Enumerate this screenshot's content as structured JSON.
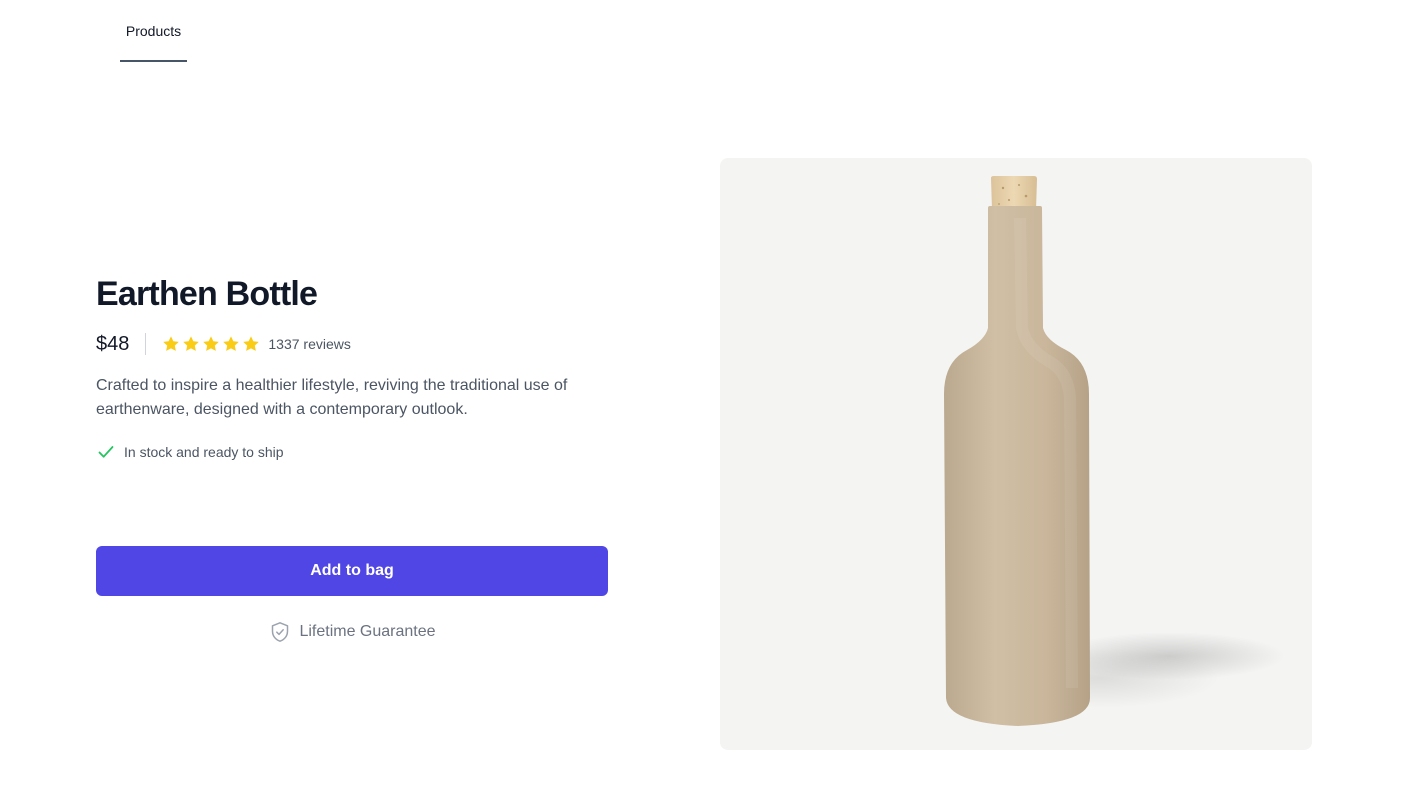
{
  "nav": {
    "tabs": [
      {
        "label": "Products",
        "active": true
      }
    ]
  },
  "product": {
    "name": "Earthen Bottle",
    "price": "$48",
    "rating": 5,
    "rating_max": 5,
    "reviews": "1337 reviews",
    "description": "Crafted to inspire a healthier lifestyle, reviving the traditional use of earthenware, designed with a contemporary outlook.",
    "stock_status": "In stock and ready to ship",
    "add_button_label": "Add to bag",
    "guarantee_label": "Lifetime Guarantee",
    "image_icon": "earthen-bottle-image"
  },
  "colors": {
    "accent": "#4f46e5",
    "star": "#facc15",
    "check": "#22c55e",
    "image_bg": "#f4f4f3",
    "bottle": "#c7b59c",
    "cork": "#e3cda6"
  }
}
